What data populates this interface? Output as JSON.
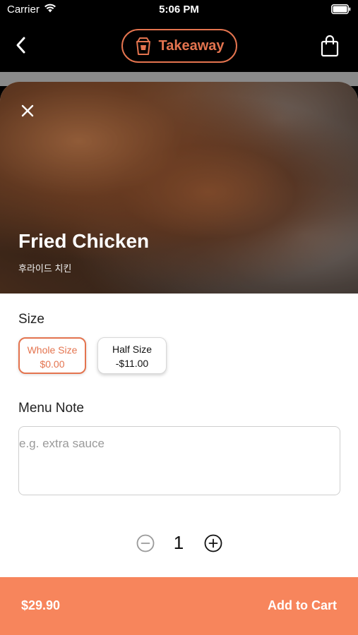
{
  "status_bar": {
    "carrier": "Carrier",
    "time": "5:06 PM",
    "icons": [
      "wifi-icon",
      "battery-icon"
    ]
  },
  "nav": {
    "back_icon": "chevron-left-icon",
    "order_mode": "Takeaway",
    "order_mode_icon": "takeaway-bag-icon",
    "cart_icon": "shopping-bag-icon"
  },
  "item": {
    "close_icon": "close-icon",
    "title": "Fried Chicken",
    "subtitle": "후라이드 치킨"
  },
  "size": {
    "label": "Size",
    "options": [
      {
        "name": "Whole Size",
        "price": "$0.00",
        "selected": true
      },
      {
        "name": "Half Size",
        "price": "-$11.00",
        "selected": false
      }
    ]
  },
  "note": {
    "label": "Menu Note",
    "placeholder": "e.g. extra sauce",
    "value": ""
  },
  "quantity": {
    "value": "1",
    "minus_icon": "minus-circle-icon",
    "plus_icon": "plus-circle-icon"
  },
  "footer": {
    "total": "$29.90",
    "action_label": "Add to Cart"
  },
  "colors": {
    "accent": "#E4744F",
    "footer_bg": "#F7855C",
    "nav_bg": "#000000"
  }
}
